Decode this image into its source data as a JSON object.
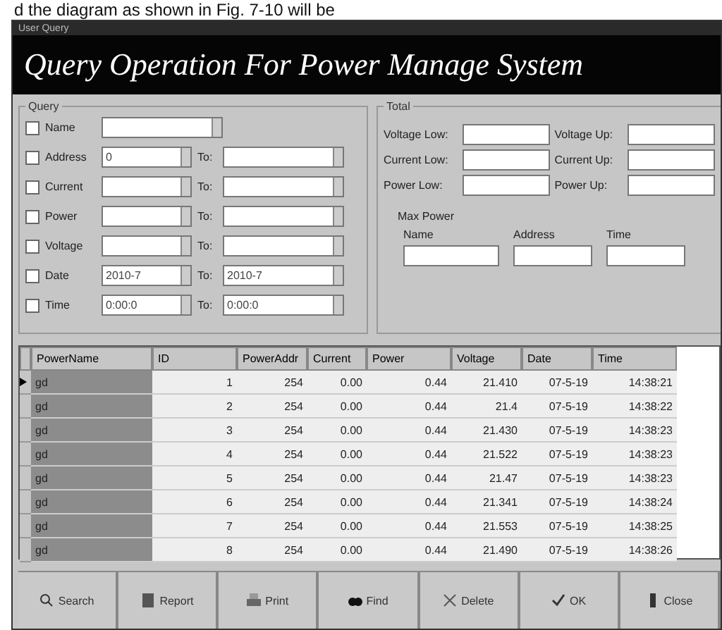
{
  "caption": "d the diagram as shown in Fig. 7-10 will be",
  "window": {
    "title": "User Query",
    "banner": "Query Operation For Power Manage System"
  },
  "query": {
    "title": "Query",
    "rows": [
      {
        "kind": "combo",
        "label": "Name",
        "checked": false,
        "from": ""
      },
      {
        "kind": "range",
        "label": "Address",
        "checked": false,
        "from": "0",
        "to_label": "To:",
        "to": ""
      },
      {
        "kind": "range",
        "label": "Current",
        "checked": false,
        "from": "",
        "to_label": "To:",
        "to": ""
      },
      {
        "kind": "range",
        "label": "Power",
        "checked": false,
        "from": "",
        "to_label": "To:",
        "to": ""
      },
      {
        "kind": "range",
        "label": "Voltage",
        "checked": false,
        "from": "",
        "to_label": "To:",
        "to": ""
      },
      {
        "kind": "range",
        "label": "Date",
        "checked": false,
        "from": "2010-7",
        "to_label": "To:",
        "to": "2010-7"
      },
      {
        "kind": "range",
        "label": "Time",
        "checked": false,
        "from": "0:00:0",
        "to_label": "To:",
        "to": "0:00:0"
      }
    ]
  },
  "total": {
    "title": "Total",
    "fields": [
      {
        "label": "Voltage Low:"
      },
      {
        "label": "Voltage Up:"
      },
      {
        "label": "Current Low:"
      },
      {
        "label": "Current Up:"
      },
      {
        "label": "Power Low:"
      },
      {
        "label": "Power Up:"
      }
    ],
    "max_power": {
      "title": "Max Power",
      "fields": [
        {
          "label": "Name"
        },
        {
          "label": "Address"
        },
        {
          "label": "Time"
        }
      ]
    }
  },
  "table": {
    "columns": [
      "PowerName",
      "ID",
      "PowerAddr",
      "Current",
      "Power",
      "Voltage",
      "Date",
      "Time"
    ],
    "rows": [
      {
        "selected": true,
        "cells": [
          "gd",
          "1",
          "254",
          "0.00",
          "0.44",
          "21.410",
          "07-5-19",
          "14:38:21"
        ]
      },
      {
        "selected": false,
        "cells": [
          "gd",
          "2",
          "254",
          "0.00",
          "0.44",
          "21.4",
          "07-5-19",
          "14:38:22"
        ]
      },
      {
        "selected": false,
        "cells": [
          "gd",
          "3",
          "254",
          "0.00",
          "0.44",
          "21.430",
          "07-5-19",
          "14:38:23"
        ]
      },
      {
        "selected": false,
        "cells": [
          "gd",
          "4",
          "254",
          "0.00",
          "0.44",
          "21.522",
          "07-5-19",
          "14:38:23"
        ]
      },
      {
        "selected": false,
        "cells": [
          "gd",
          "5",
          "254",
          "0.00",
          "0.44",
          "21.47",
          "07-5-19",
          "14:38:23"
        ]
      },
      {
        "selected": false,
        "cells": [
          "gd",
          "6",
          "254",
          "0.00",
          "0.44",
          "21.341",
          "07-5-19",
          "14:38:24"
        ]
      },
      {
        "selected": false,
        "cells": [
          "gd",
          "7",
          "254",
          "0.00",
          "0.44",
          "21.553",
          "07-5-19",
          "14:38:25"
        ]
      },
      {
        "selected": false,
        "cells": [
          "gd",
          "8",
          "254",
          "0.00",
          "0.44",
          "21.490",
          "07-5-19",
          "14:38:26"
        ]
      }
    ]
  },
  "buttons": [
    {
      "kind": "search",
      "label": "Search"
    },
    {
      "kind": "report",
      "label": "Report"
    },
    {
      "kind": "print",
      "label": "Print"
    },
    {
      "kind": "find",
      "label": "Find"
    },
    {
      "kind": "delete",
      "label": "Delete"
    },
    {
      "kind": "ok",
      "label": "OK"
    },
    {
      "kind": "close",
      "label": "Close"
    }
  ]
}
